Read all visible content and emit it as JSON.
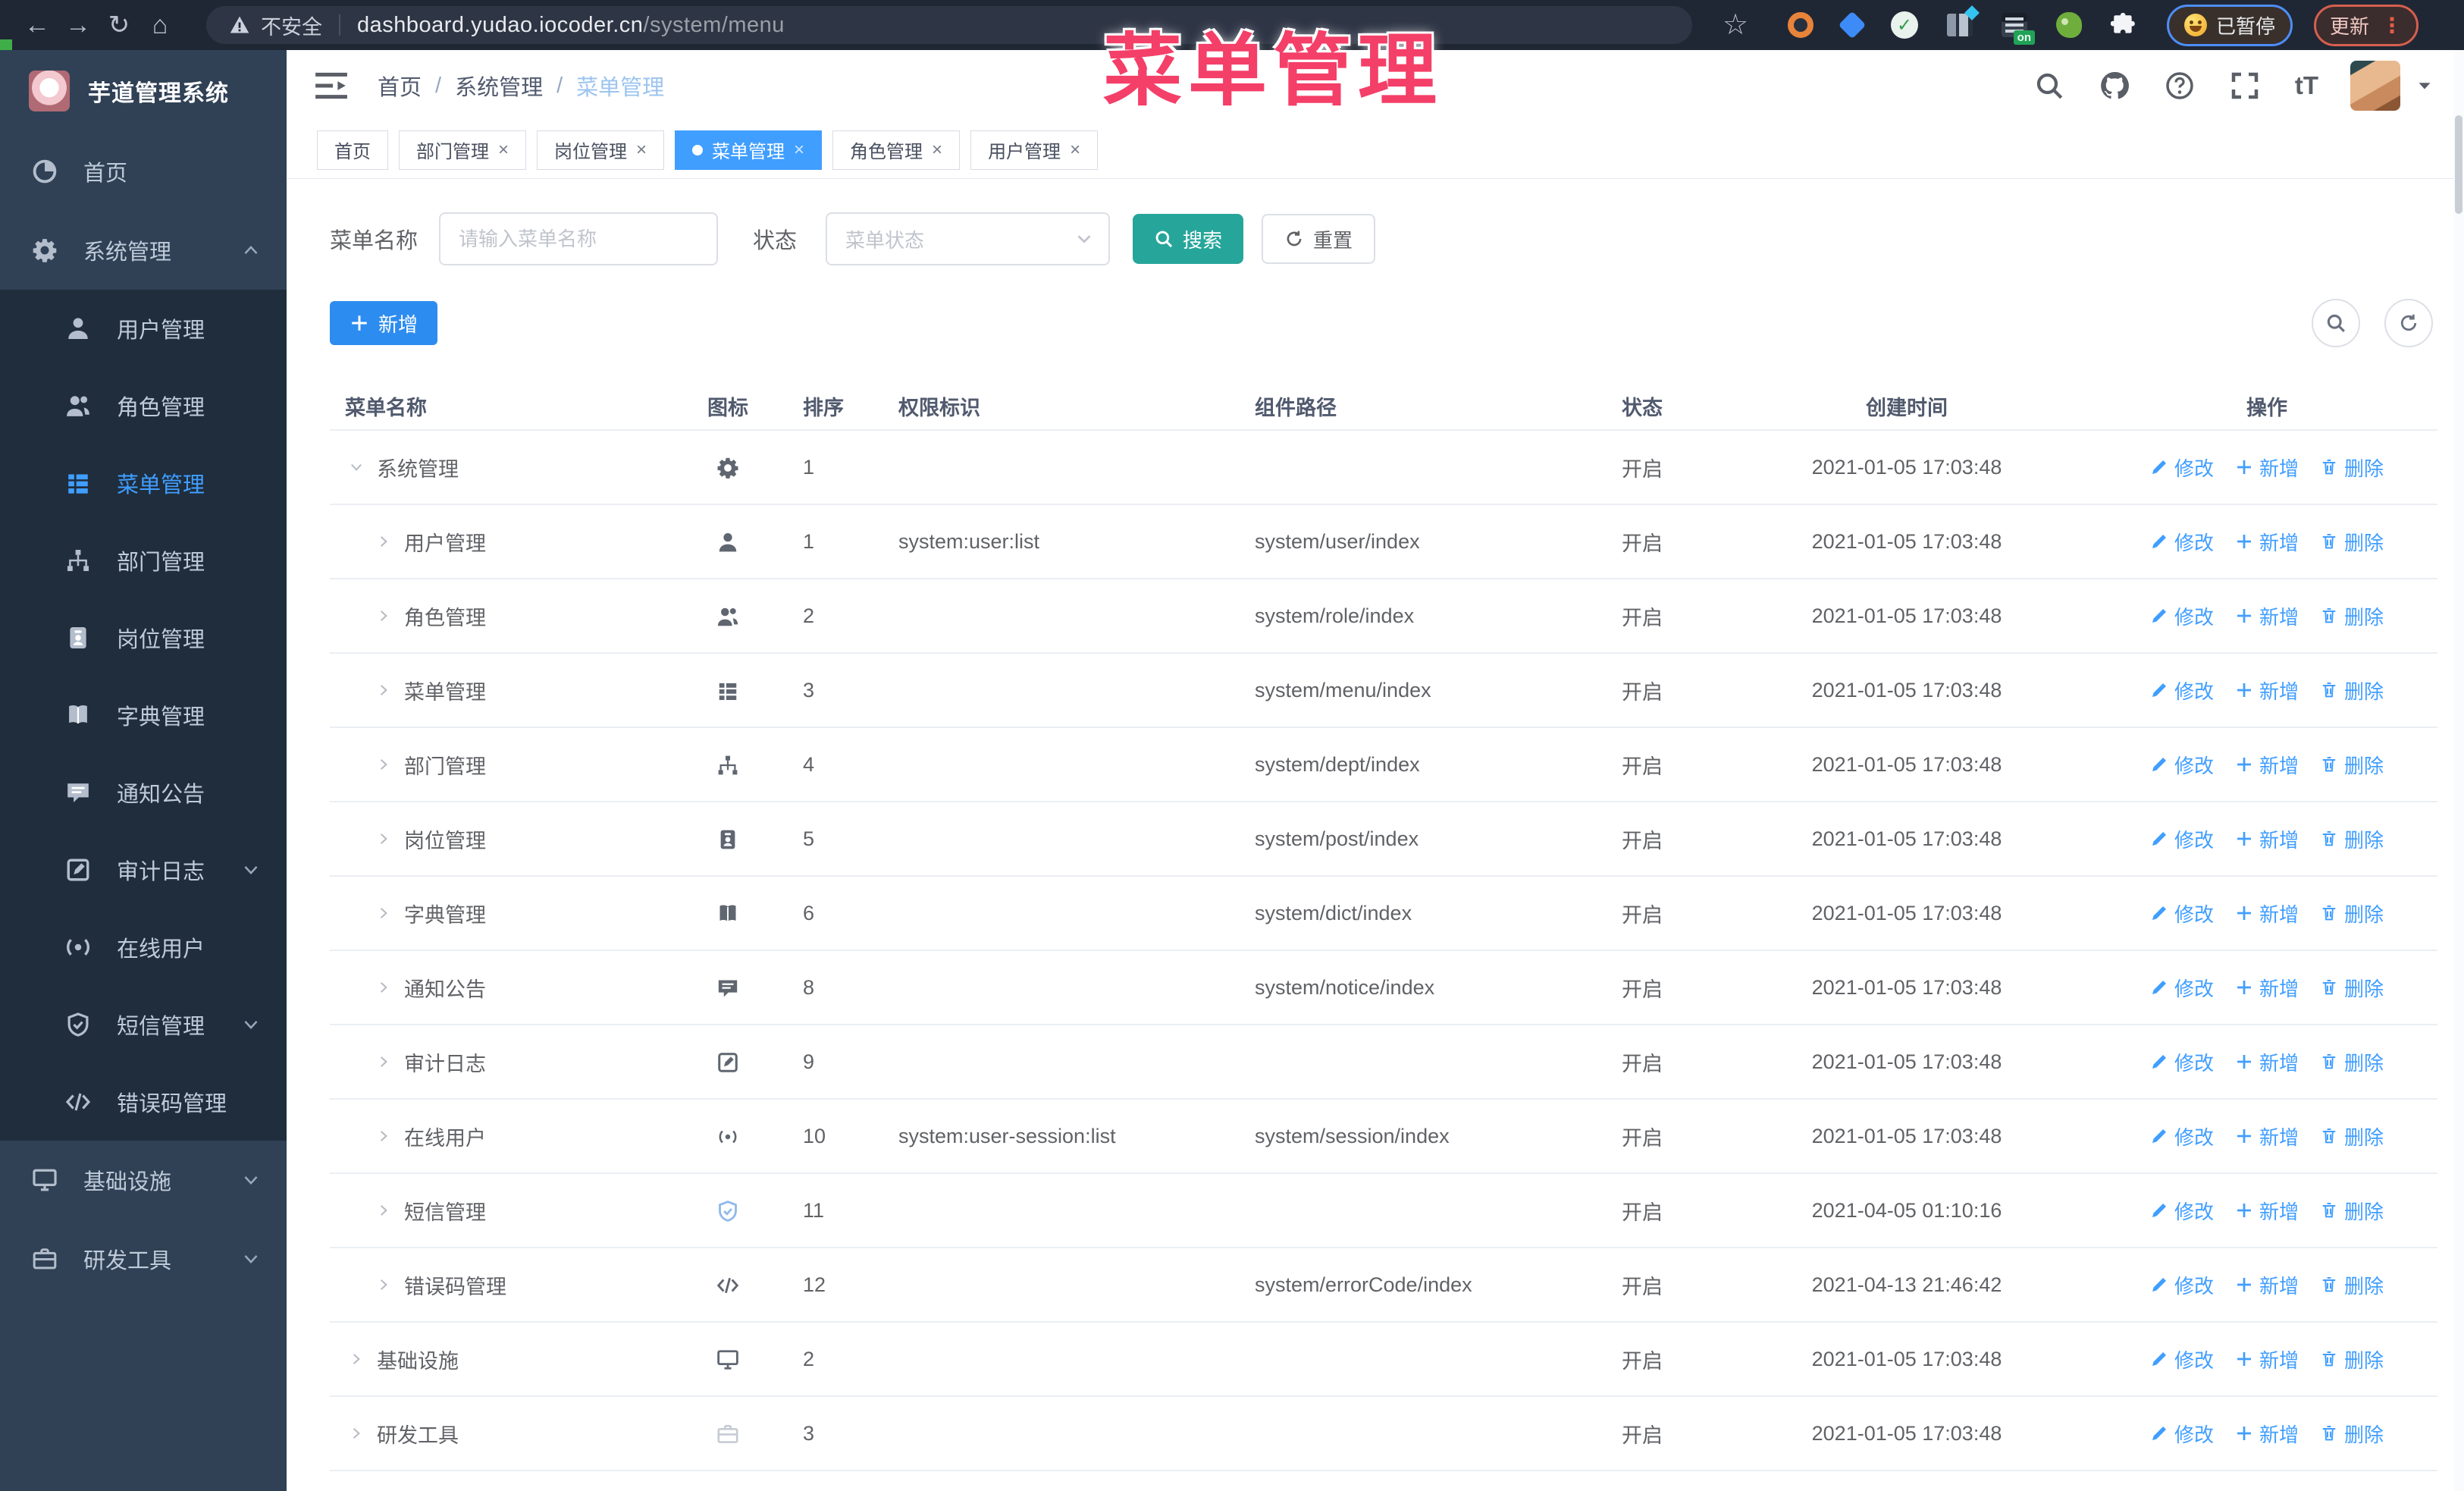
{
  "browser": {
    "security_label": "不安全",
    "url_host": "dashboard.yudao.iocoder.cn",
    "url_path": "/system/menu",
    "paused_label": "已暂停",
    "update_label": "更新",
    "extension_badge": "on"
  },
  "annotation": {
    "text": "菜单管理",
    "color": "#f43f68"
  },
  "sidebar": {
    "title": "芋道管理系统",
    "items": [
      {
        "label": "首页",
        "icon": "dashboard"
      },
      {
        "label": "系统管理",
        "icon": "gear",
        "arrow": "up",
        "children": [
          {
            "label": "用户管理",
            "icon": "user"
          },
          {
            "label": "角色管理",
            "icon": "users"
          },
          {
            "label": "菜单管理",
            "icon": "menu",
            "active": true
          },
          {
            "label": "部门管理",
            "icon": "tree"
          },
          {
            "label": "岗位管理",
            "icon": "badge"
          },
          {
            "label": "字典管理",
            "icon": "book"
          },
          {
            "label": "通知公告",
            "icon": "message"
          },
          {
            "label": "审计日志",
            "icon": "edit",
            "arrow": "down"
          },
          {
            "label": "在线用户",
            "icon": "online"
          },
          {
            "label": "短信管理",
            "icon": "shield",
            "arrow": "down"
          },
          {
            "label": "错误码管理",
            "icon": "code"
          }
        ]
      },
      {
        "label": "基础设施",
        "icon": "monitor",
        "arrow": "down"
      },
      {
        "label": "研发工具",
        "icon": "toolbox",
        "arrow": "down"
      }
    ]
  },
  "header": {
    "breadcrumb": [
      "首页",
      "系统管理",
      "菜单管理"
    ],
    "icons": [
      "search",
      "github",
      "help",
      "fullscreen",
      "fontsize"
    ]
  },
  "tabs": [
    {
      "label": "首页",
      "closable": false,
      "active": false
    },
    {
      "label": "部门管理",
      "closable": true,
      "active": false
    },
    {
      "label": "岗位管理",
      "closable": true,
      "active": false
    },
    {
      "label": "菜单管理",
      "closable": true,
      "active": true
    },
    {
      "label": "角色管理",
      "closable": true,
      "active": false
    },
    {
      "label": "用户管理",
      "closable": true,
      "active": false
    }
  ],
  "filters": {
    "name_label": "菜单名称",
    "name_placeholder": "请输入菜单名称",
    "status_label": "状态",
    "status_placeholder": "菜单状态",
    "search_label": "搜索",
    "reset_label": "重置"
  },
  "toolbar": {
    "add_label": "新增"
  },
  "table": {
    "columns": [
      "菜单名称",
      "图标",
      "排序",
      "权限标识",
      "组件路径",
      "状态",
      "创建时间",
      "操作"
    ],
    "actions": [
      "修改",
      "新增",
      "删除"
    ],
    "rows": [
      {
        "name": "系统管理",
        "icon": "gear",
        "level": 0,
        "expanded": true,
        "sort": "1",
        "perm": "",
        "path": "",
        "status": "开启",
        "time": "2021-01-05 17:03:48"
      },
      {
        "name": "用户管理",
        "icon": "user",
        "level": 1,
        "sort": "1",
        "perm": "system:user:list",
        "path": "system/user/index",
        "status": "开启",
        "time": "2021-01-05 17:03:48"
      },
      {
        "name": "角色管理",
        "icon": "users",
        "level": 1,
        "sort": "2",
        "perm": "",
        "path": "system/role/index",
        "status": "开启",
        "time": "2021-01-05 17:03:48"
      },
      {
        "name": "菜单管理",
        "icon": "menu",
        "level": 1,
        "sort": "3",
        "perm": "",
        "path": "system/menu/index",
        "status": "开启",
        "time": "2021-01-05 17:03:48"
      },
      {
        "name": "部门管理",
        "icon": "tree",
        "level": 1,
        "sort": "4",
        "perm": "",
        "path": "system/dept/index",
        "status": "开启",
        "time": "2021-01-05 17:03:48"
      },
      {
        "name": "岗位管理",
        "icon": "badge",
        "level": 1,
        "sort": "5",
        "perm": "",
        "path": "system/post/index",
        "status": "开启",
        "time": "2021-01-05 17:03:48"
      },
      {
        "name": "字典管理",
        "icon": "book",
        "level": 1,
        "sort": "6",
        "perm": "",
        "path": "system/dict/index",
        "status": "开启",
        "time": "2021-01-05 17:03:48"
      },
      {
        "name": "通知公告",
        "icon": "message",
        "level": 1,
        "sort": "8",
        "perm": "",
        "path": "system/notice/index",
        "status": "开启",
        "time": "2021-01-05 17:03:48"
      },
      {
        "name": "审计日志",
        "icon": "edit",
        "level": 1,
        "sort": "9",
        "perm": "",
        "path": "",
        "status": "开启",
        "time": "2021-01-05 17:03:48"
      },
      {
        "name": "在线用户",
        "icon": "online",
        "level": 1,
        "sort": "10",
        "perm": "system:user-session:list",
        "path": "system/session/index",
        "status": "开启",
        "time": "2021-01-05 17:03:48"
      },
      {
        "name": "短信管理",
        "icon": "shield",
        "level": 1,
        "sort": "11",
        "perm": "",
        "path": "",
        "status": "开启",
        "time": "2021-04-05 01:10:16"
      },
      {
        "name": "错误码管理",
        "icon": "code",
        "level": 1,
        "sort": "12",
        "perm": "",
        "path": "system/errorCode/index",
        "status": "开启",
        "time": "2021-04-13 21:46:42"
      },
      {
        "name": "基础设施",
        "icon": "monitor",
        "level": 0,
        "sort": "2",
        "perm": "",
        "path": "",
        "status": "开启",
        "time": "2021-01-05 17:03:48"
      },
      {
        "name": "研发工具",
        "icon": "toolbox",
        "level": 0,
        "sort": "3",
        "perm": "",
        "path": "",
        "status": "开启",
        "time": "2021-01-05 17:03:48"
      }
    ]
  },
  "colors": {
    "primary": "#409EFF",
    "search_teal": "#26A69A",
    "add_blue": "#2D8CF0",
    "sidebar_bg": "#304156",
    "submenu_bg": "#1f2d3d"
  }
}
